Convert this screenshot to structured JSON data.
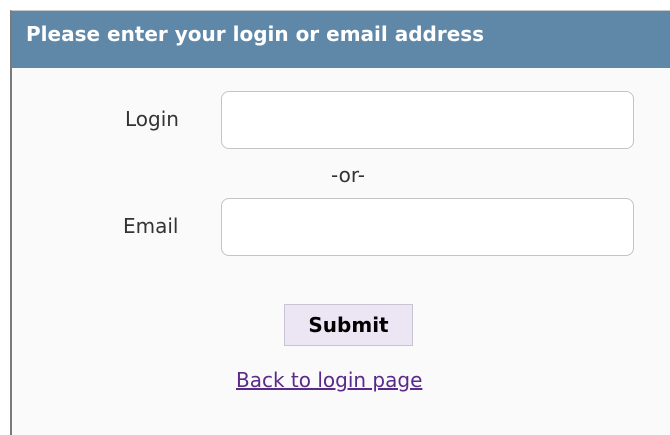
{
  "panel": {
    "title": "Please enter your login or email address",
    "header_color": "#5f88a8"
  },
  "form": {
    "login_label": "Login",
    "login_value": "",
    "separator": "-or-",
    "email_label": "Email",
    "email_value": "",
    "submit_label": "Submit",
    "back_link_label": "Back to login page",
    "link_color": "#5a2a8a"
  }
}
